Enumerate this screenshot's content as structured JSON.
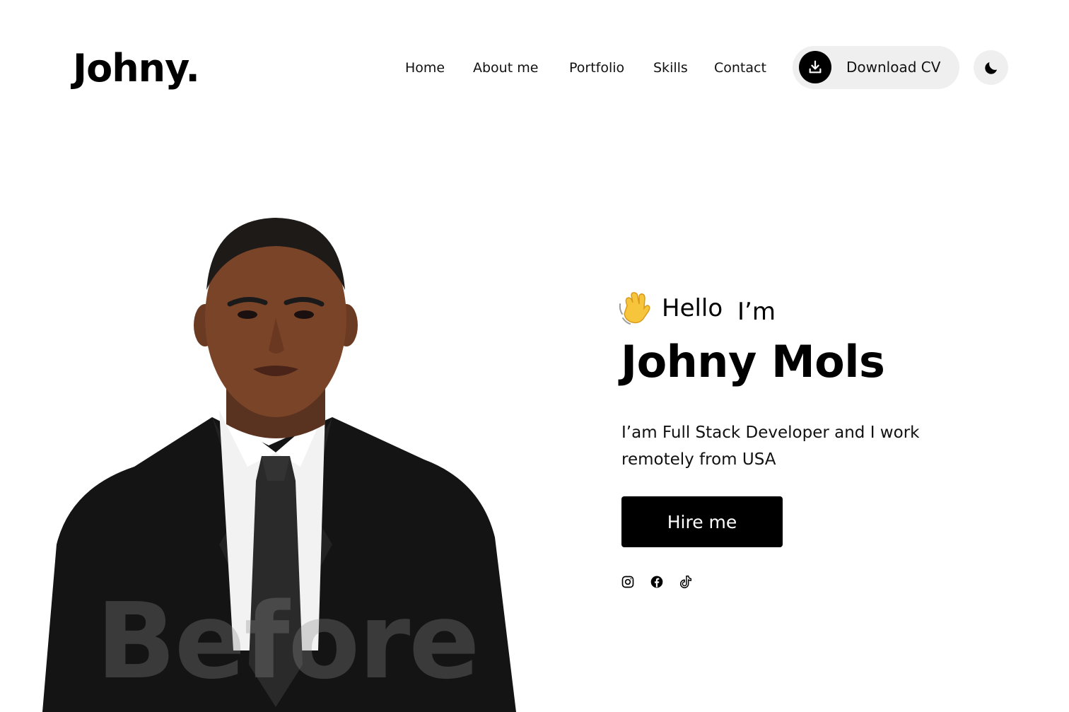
{
  "header": {
    "logo": "Johny.",
    "nav": [
      "Home",
      "About me",
      "Portfolio",
      "Skills",
      "Contact"
    ],
    "download_label": "Download CV",
    "download_icon": "download-icon",
    "theme_icon": "moon-icon"
  },
  "hero": {
    "greeting_emoji": "waving-hand-icon",
    "hello": "Hello",
    "im": "I’m",
    "name": "Johny Mols",
    "description": "I’am Full Stack Developer and I work remotely from USA",
    "cta": "Hire me",
    "watermark": "Before",
    "socials": [
      "instagram-icon",
      "facebook-icon",
      "tiktok-icon"
    ]
  },
  "colors": {
    "background": "#ffffff",
    "text": "#000000",
    "button_bg": "#000000",
    "pill_bg": "#efefef"
  }
}
